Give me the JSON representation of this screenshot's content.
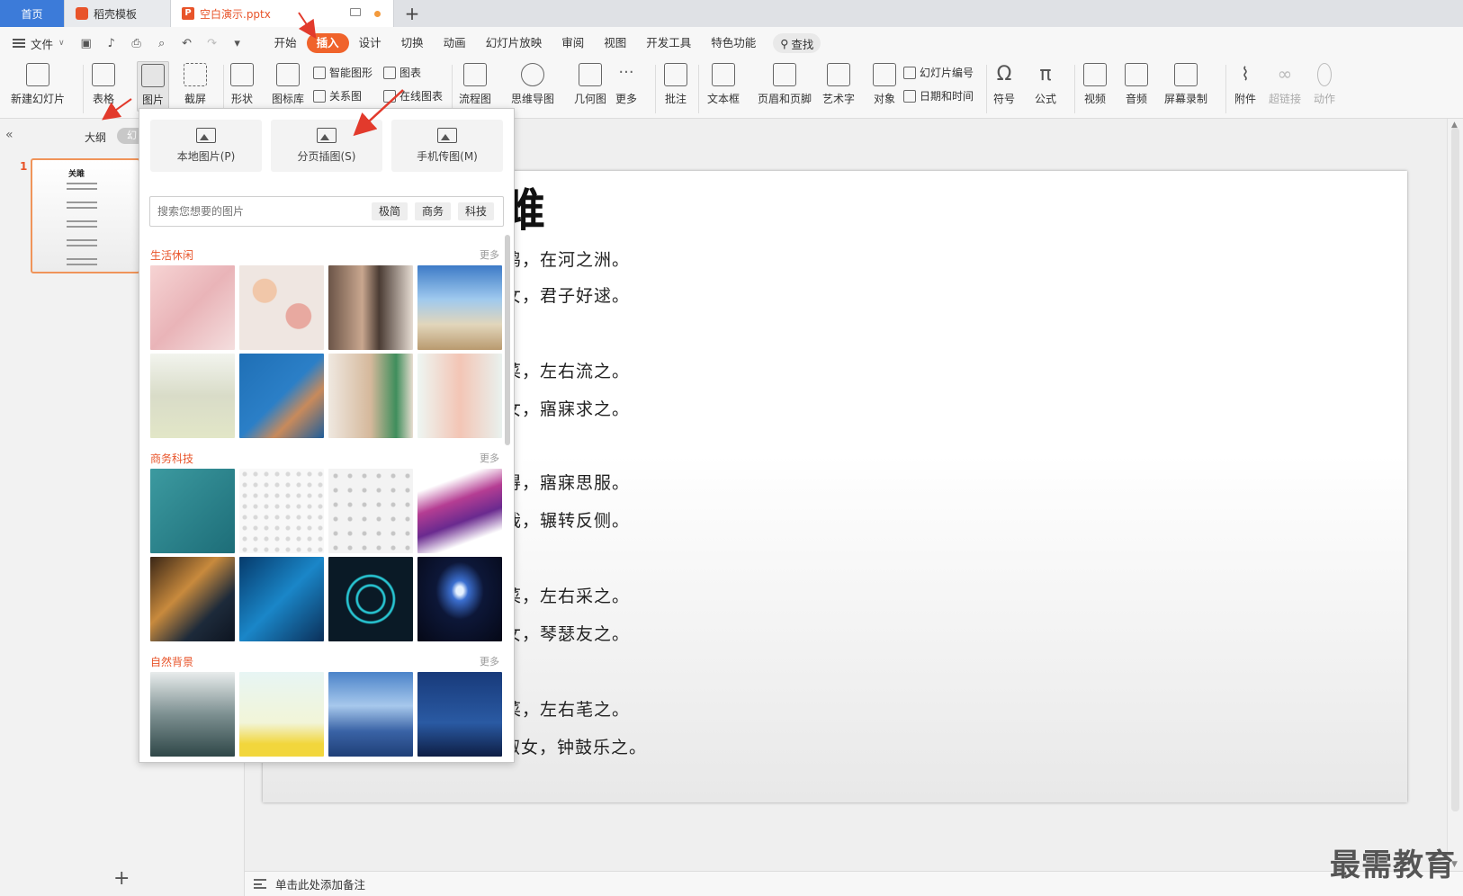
{
  "tabs": {
    "home": "首页",
    "templates": "稻壳模板",
    "document": "空白演示.pptx"
  },
  "menu": {
    "file": "文件",
    "items": [
      "开始",
      "插入",
      "设计",
      "切换",
      "动画",
      "幻灯片放映",
      "审阅",
      "视图",
      "开发工具",
      "特色功能"
    ],
    "active": "插入",
    "search": "查找"
  },
  "ribbon": {
    "new_slide": "新建幻灯片",
    "table": "表格",
    "picture": "图片",
    "screenshot": "截屏",
    "shape": "形状",
    "icon_lib": "图标库",
    "smart_shape": "智能图形",
    "chart": "图表",
    "relation": "关系图",
    "online_chart": "在线图表",
    "flowchart": "流程图",
    "mindmap": "思维导图",
    "geometry": "几何图",
    "more": "更多",
    "comment": "批注",
    "textbox": "文本框",
    "header_footer": "页眉和页脚",
    "wordart": "艺术字",
    "object": "对象",
    "slide_number": "幻灯片编号",
    "date_time": "日期和时间",
    "symbol": "符号",
    "formula": "公式",
    "video": "视频",
    "audio": "音频",
    "screen_record": "屏幕录制",
    "attachment": "附件",
    "hyperlink": "超链接",
    "action": "动作"
  },
  "left_panel": {
    "outline": "大纲",
    "slides": "幻",
    "slide_number": "1",
    "thumb_title": "关雎"
  },
  "dropdown": {
    "local_picture": "本地图片(P)",
    "paged_insert": "分页插图(S)",
    "phone_transfer": "手机传图(M)",
    "search_placeholder": "搜索您想要的图片",
    "chips": [
      "极简",
      "商务",
      "科技"
    ],
    "sections": [
      {
        "title": "生活休闲",
        "more": "更多"
      },
      {
        "title": "商务科技",
        "more": "更多"
      },
      {
        "title": "自然背景",
        "more": "更多"
      }
    ]
  },
  "slide": {
    "title": "雎",
    "lines": [
      "鸠，在河之洲。",
      "女，君子好逑。",
      "菜，左右流之。",
      "女，寤寐求之。",
      "得，寤寐思服。",
      "哉，辗转反侧。",
      "菜，左右采之。",
      "女，琴瑟友之。",
      "菜，左右芼之。",
      "窈窕淑女，钟鼓乐之。"
    ]
  },
  "notes": "单击此处添加备注",
  "watermark": "最需教育",
  "colors": {
    "accent": "#f0632b",
    "tab_home": "#3c7bd9",
    "arrow": "#e23a2c"
  }
}
